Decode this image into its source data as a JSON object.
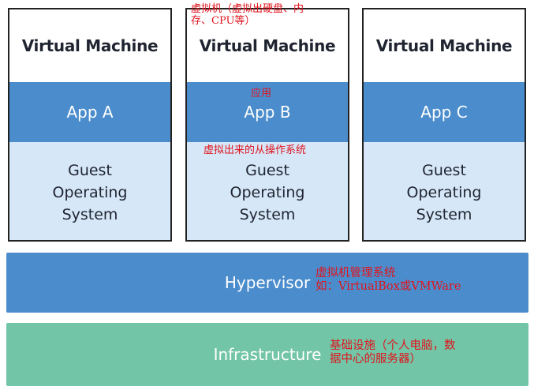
{
  "machines": [
    {
      "title": "Virtual Machine",
      "app": "App A",
      "os": "Guest\nOperating\nSystem"
    },
    {
      "title": "Virtual Machine",
      "app": "App B",
      "os": "Guest\nOperating\nSystem"
    },
    {
      "title": "Virtual Machine",
      "app": "App C",
      "os": "Guest\nOperating\nSystem"
    }
  ],
  "hypervisor": {
    "label": "Hypervisor"
  },
  "infrastructure": {
    "label": "Infrastructure"
  },
  "annotations": {
    "vm": "虚拟机（虚拟出硬盘、内\n存、CPU等）",
    "app": "应用",
    "guest_os": "虚拟出来的从操作系统",
    "hypervisor": "虚拟机管理系统\n如：VirtualBox或VMWare",
    "infrastructure": "基础设施（个人电脑，数\n据中心的服务器）"
  },
  "colors": {
    "app_layer": "#4b8dcc",
    "guest_os_layer": "#d6e7f7",
    "hypervisor_layer": "#4b8dcc",
    "infrastructure_layer": "#72c5a6",
    "annotation_text": "#e0141e"
  }
}
